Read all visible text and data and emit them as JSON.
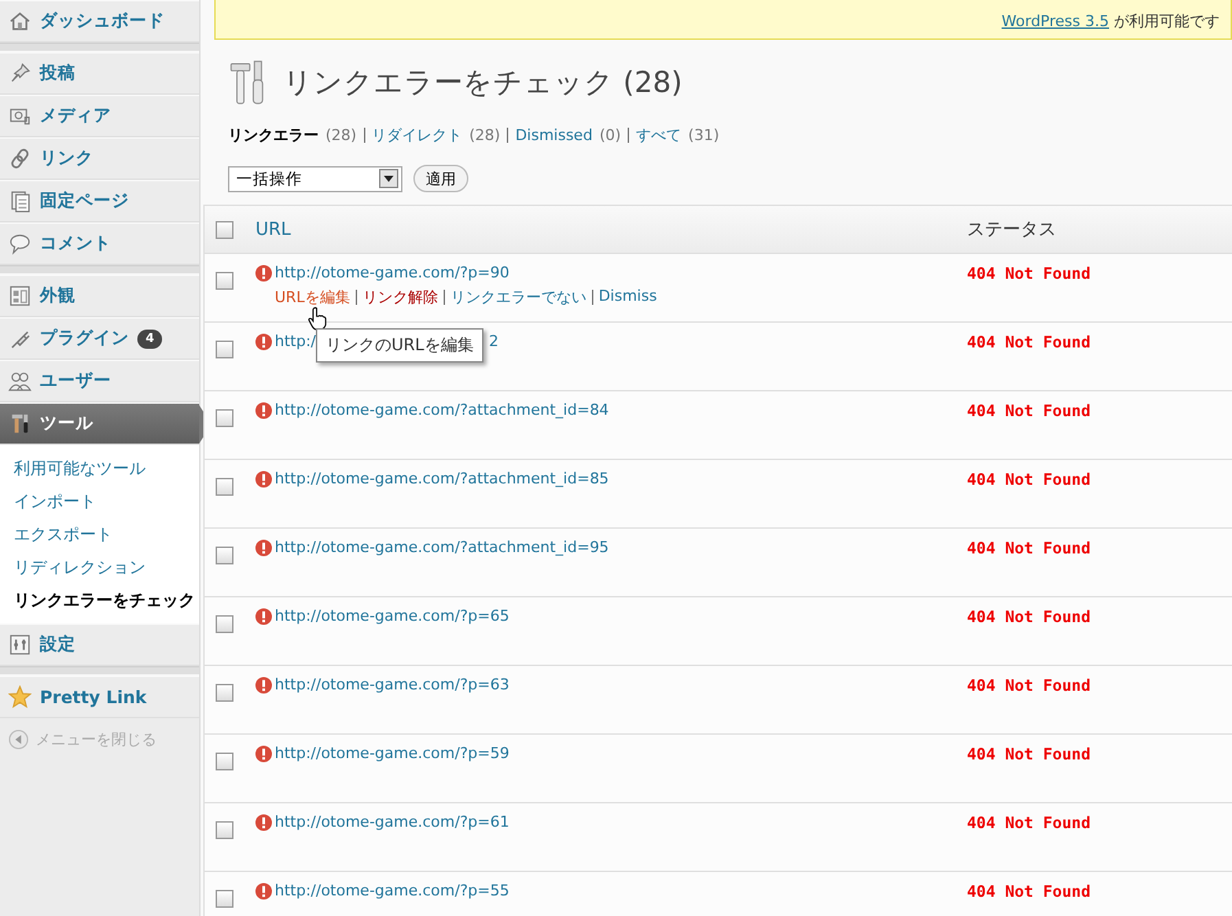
{
  "sidebar": {
    "groups": [
      [
        {
          "label": "ダッシュボード",
          "selected": false
        }
      ],
      [
        {
          "label": "投稿",
          "selected": false
        },
        {
          "label": "メディア",
          "selected": false
        },
        {
          "label": "リンク",
          "selected": false
        },
        {
          "label": "固定ページ",
          "selected": false
        },
        {
          "label": "コメント",
          "selected": false
        }
      ],
      [
        {
          "label": "外観",
          "selected": false
        },
        {
          "label": "プラグイン",
          "selected": false,
          "badge": "4"
        },
        {
          "label": "ユーザー",
          "selected": false
        },
        {
          "label": "ツール",
          "selected": true,
          "children": [
            {
              "label": "利用可能なツール",
              "selected": false
            },
            {
              "label": "インポート",
              "selected": false
            },
            {
              "label": "エクスポート",
              "selected": false
            },
            {
              "label": "リディレクション",
              "selected": false
            },
            {
              "label": "リンクエラーをチェック",
              "selected": true
            }
          ]
        },
        {
          "label": "設定",
          "selected": false
        }
      ],
      [
        {
          "label": "Pretty Link",
          "selected": false
        }
      ]
    ],
    "collapse": "メニューを閉じる"
  },
  "notice": {
    "link": "WordPress 3.5",
    "text": "が利用可能です"
  },
  "page_title": "リンクエラーをチェック (28)",
  "filters": [
    {
      "label": "リンクエラー",
      "count": "(28)",
      "selected": true
    },
    {
      "label": "リダイレクト",
      "count": "(28)",
      "selected": false
    },
    {
      "label": "Dismissed",
      "count": "(0)",
      "selected": false
    },
    {
      "label": "すべて",
      "count": "(31)",
      "selected": false
    }
  ],
  "bulk_actions": {
    "value": "一括操作"
  },
  "apply_button": "適用",
  "table": {
    "columns": [
      "URL",
      "ステータス"
    ],
    "header_checked": false,
    "rows": [
      {
        "url": "http://otome-game.com/?p=90",
        "status": "404 Not Found",
        "checked": false,
        "actions": [
          {
            "label": "URLを編集",
            "kind": "hover"
          },
          {
            "label": "リンク解除",
            "kind": "delete"
          },
          {
            "label": "リンクエラーでない",
            "kind": "link"
          },
          {
            "label": "Dismiss",
            "kind": "link"
          }
        ]
      },
      {
        "url": "http:/",
        "url_tail": "2",
        "status": "404 Not Found",
        "checked": false
      },
      {
        "url": "http://otome-game.com/?attachment_id=84",
        "status": "404 Not Found",
        "checked": false
      },
      {
        "url": "http://otome-game.com/?attachment_id=85",
        "status": "404 Not Found",
        "checked": false
      },
      {
        "url": "http://otome-game.com/?attachment_id=95",
        "status": "404 Not Found",
        "checked": false
      },
      {
        "url": "http://otome-game.com/?p=65",
        "status": "404 Not Found",
        "checked": false
      },
      {
        "url": "http://otome-game.com/?p=63",
        "status": "404 Not Found",
        "checked": false
      },
      {
        "url": "http://otome-game.com/?p=59",
        "status": "404 Not Found",
        "checked": false
      },
      {
        "url": "http://otome-game.com/?p=61",
        "status": "404 Not Found",
        "checked": false
      },
      {
        "url": "http://otome-game.com/?p=55",
        "status": "404 Not Found",
        "checked": false
      }
    ]
  },
  "tooltip": "リンクのURLを編集"
}
